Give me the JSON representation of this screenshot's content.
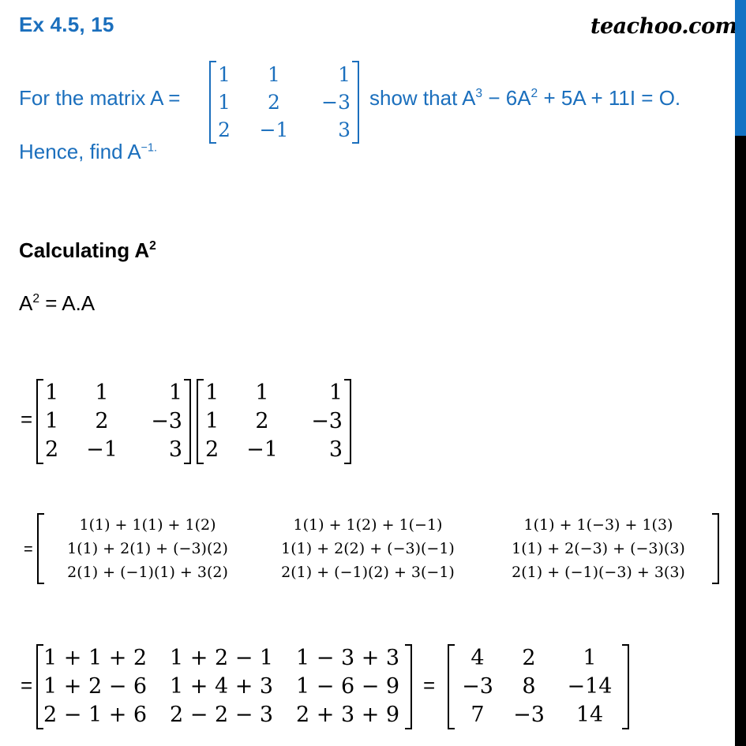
{
  "header": {
    "exercise": "Ex 4.5,  15",
    "logo": "teachoo.com"
  },
  "colors": {
    "question": "#1b6fbd",
    "sidebar_top": "#1272c4",
    "sidebar_bottom": "#000000"
  },
  "question": {
    "prefix": "For the matrix A =",
    "show_that": "show that A",
    "exp3": "3",
    "minus6": " − 6A",
    "exp2": "2",
    "rest": " + 5A + 11I = O.",
    "hence": "Hence, find A",
    "inv_exp": "−1.",
    "matrix_A": [
      [
        "1",
        "1",
        "1"
      ],
      [
        "1",
        "2",
        "−3"
      ],
      [
        "2",
        "−1",
        "3"
      ]
    ]
  },
  "section": {
    "title": "Calculating A",
    "title_exp": "2",
    "def_lhs": "A",
    "def_exp": "2",
    "def_rhs": " = A.A"
  },
  "equals": "=",
  "product": {
    "left": [
      [
        "1",
        "1",
        "1"
      ],
      [
        "1",
        "2",
        "−3"
      ],
      [
        "2",
        "−1",
        "3"
      ]
    ],
    "right": [
      [
        "1",
        "1",
        "1"
      ],
      [
        "1",
        "2",
        "−3"
      ],
      [
        "2",
        "−1",
        "3"
      ]
    ]
  },
  "expanded": [
    [
      "1(1) + 1(1) + 1(2)",
      "1(1) + 1(2) + 1(−1)",
      "1(1) + 1(−3) + 1(3)"
    ],
    [
      "1(1) + 2(1) + (−3)(2)",
      "1(1) + 2(2) + (−3)(−1)",
      "1(1) + 2(−3) + (−3)(3)"
    ],
    [
      "2(1) + (−1)(1) + 3(2)",
      "2(1) + (−1)(2) + 3(−1)",
      "2(1) + (−1)(−3) + 3(3)"
    ]
  ],
  "sums": [
    [
      "1 + 1 + 2",
      "1 + 2 − 1",
      "1 − 3 + 3"
    ],
    [
      "1 + 2 − 6",
      "1 + 4 + 3",
      "1 − 6 − 9"
    ],
    [
      "2 − 1 + 6",
      "2 − 2 − 3",
      "2 + 3 + 9"
    ]
  ],
  "result": [
    [
      "4",
      "2",
      "1"
    ],
    [
      "−3",
      "8",
      "−14"
    ],
    [
      "7",
      "−3",
      "14"
    ]
  ]
}
